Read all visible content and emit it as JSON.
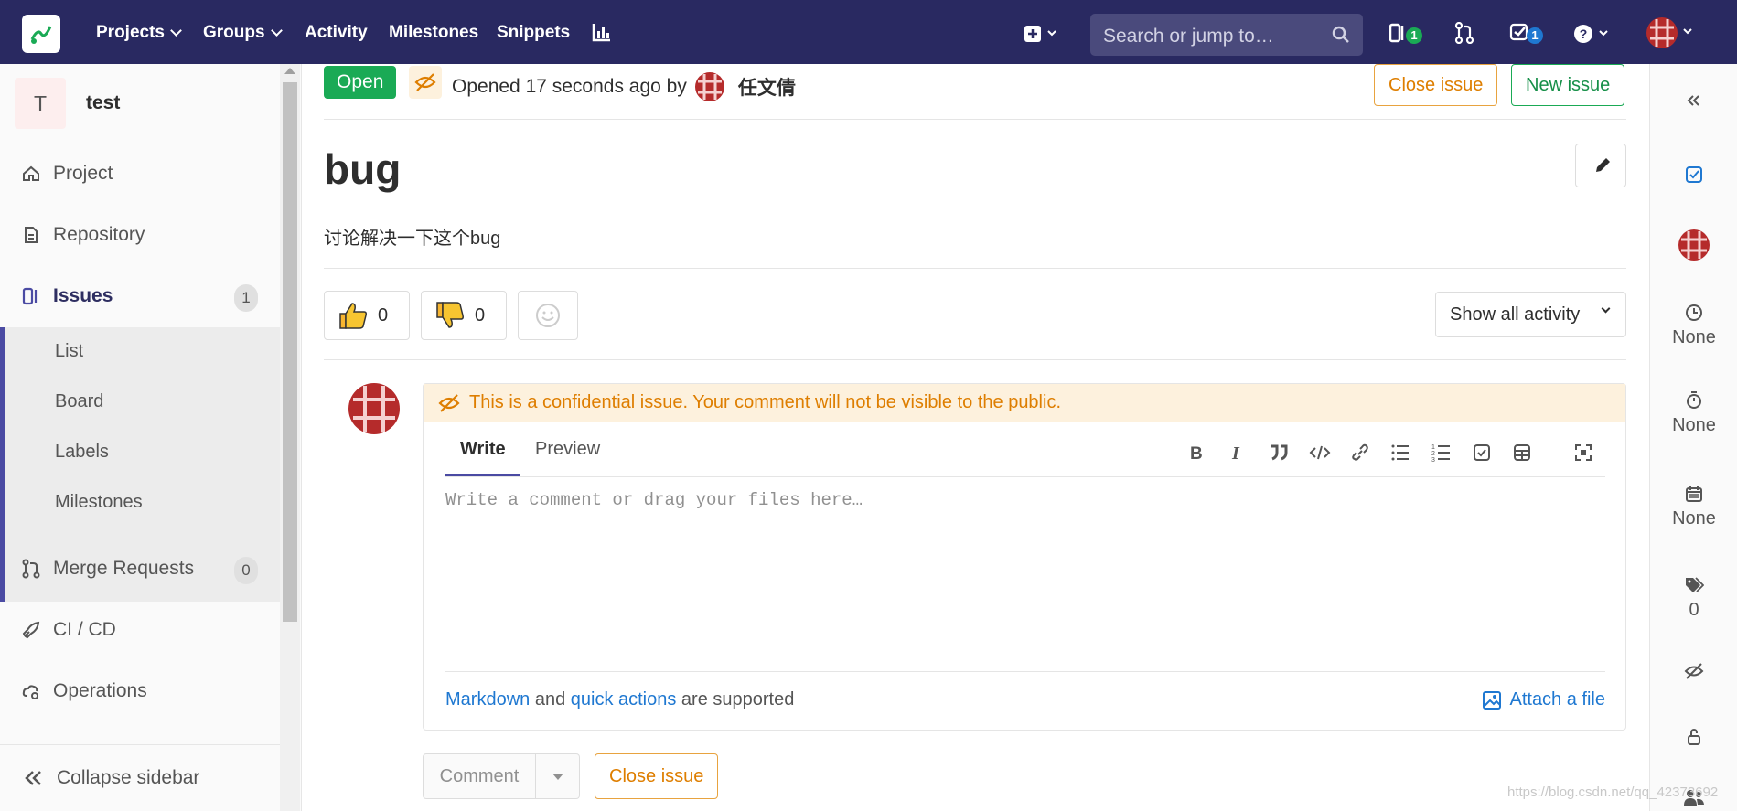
{
  "nav": {
    "items": [
      "Projects",
      "Groups",
      "Activity",
      "Milestones",
      "Snippets"
    ],
    "search_placeholder": "Search or jump to…",
    "issues_count": "1",
    "todos_count": "1"
  },
  "sidebar": {
    "project_avatar": "T",
    "project_name": "test",
    "items": {
      "project": "Project",
      "repository": "Repository",
      "issues": "Issues",
      "issues_count": "1",
      "merge_requests": "Merge Requests",
      "merge_requests_count": "0",
      "cicd": "CI / CD",
      "operations": "Operations"
    },
    "issues_sub": [
      "List",
      "Board",
      "Labels",
      "Milestones"
    ],
    "collapse_label": "Collapse sidebar"
  },
  "issue": {
    "status": "Open",
    "opened_text": "Opened 17 seconds ago by",
    "author": "任文倩",
    "close_label": "Close issue",
    "new_label": "New issue",
    "title": "bug",
    "description": "讨论解决一下这个bug",
    "thumbs_up": "0",
    "thumbs_down": "0",
    "activity_filter": "Show all activity"
  },
  "comment": {
    "confidential_notice": "This is a confidential issue. Your comment will not be visible to the public.",
    "tab_write": "Write",
    "tab_preview": "Preview",
    "placeholder": "Write a comment or drag your files here…",
    "markdown_link": "Markdown",
    "and_text": " and ",
    "quick_actions_link": "quick actions",
    "supported_text": " are supported",
    "attach_label": "Attach a file",
    "comment_button": "Comment",
    "close_button": "Close issue"
  },
  "right_sidebar": {
    "milestone": "None",
    "time_tracking": "None",
    "due_date": "None",
    "labels_count": "0"
  },
  "watermark": "https://blog.csdn.net/qq_42373692",
  "colors": {
    "nav_bg": "#292961",
    "open_green": "#1aaa55",
    "warning_orange": "#de7e00",
    "link_blue": "#1f78d1",
    "active_indigo": "#4b4ba3"
  }
}
